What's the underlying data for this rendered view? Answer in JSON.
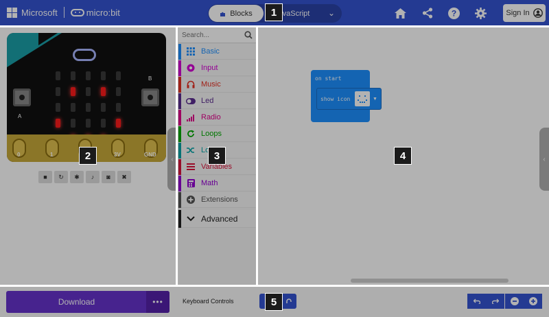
{
  "header": {
    "brand": "Microsoft",
    "product": "micro:bit",
    "blocks_label": "Blocks",
    "javascript_label": "JavaScript",
    "signin_label": "Sign In",
    "icons": [
      "home-icon",
      "share-icon",
      "help-icon",
      "settings-icon"
    ]
  },
  "simulator": {
    "pin_labels": [
      "0",
      "1",
      "2",
      "3V",
      "GND"
    ],
    "button_a": "A",
    "button_b": "B",
    "toolbar": [
      "stop-icon",
      "restart-icon",
      "debug-icon",
      "mute-icon",
      "screenshot-icon",
      "fullscreen-icon"
    ]
  },
  "toolbox": {
    "search_placeholder": "Search...",
    "categories": [
      {
        "label": "Basic",
        "color": "#1e90ff"
      },
      {
        "label": "Input",
        "color": "#d400d4"
      },
      {
        "label": "Music",
        "color": "#e63022"
      },
      {
        "label": "Led",
        "color": "#5c2d91"
      },
      {
        "label": "Radio",
        "color": "#e3008c"
      },
      {
        "label": "Loops",
        "color": "#00aa00"
      },
      {
        "label": "Logic",
        "color": "#00a4a6"
      },
      {
        "label": "Variables",
        "color": "#dc143c"
      },
      {
        "label": "Math",
        "color": "#9400d3"
      },
      {
        "label": "Extensions",
        "color": "#555555"
      }
    ],
    "advanced_label": "Advanced"
  },
  "workspace": {
    "on_start_label": "on start",
    "show_icon_label": "show icon"
  },
  "footer": {
    "download_label": "Download",
    "download_more": "•••",
    "keyboard_controls_label": "Keyboard Controls"
  },
  "callouts": [
    "1",
    "2",
    "3",
    "4",
    "5"
  ],
  "colors": {
    "header_bg": "#3454d1",
    "download_bg": "#6633cc",
    "block_blue": "#1e90ff",
    "led_on": "#ff1b1b"
  }
}
